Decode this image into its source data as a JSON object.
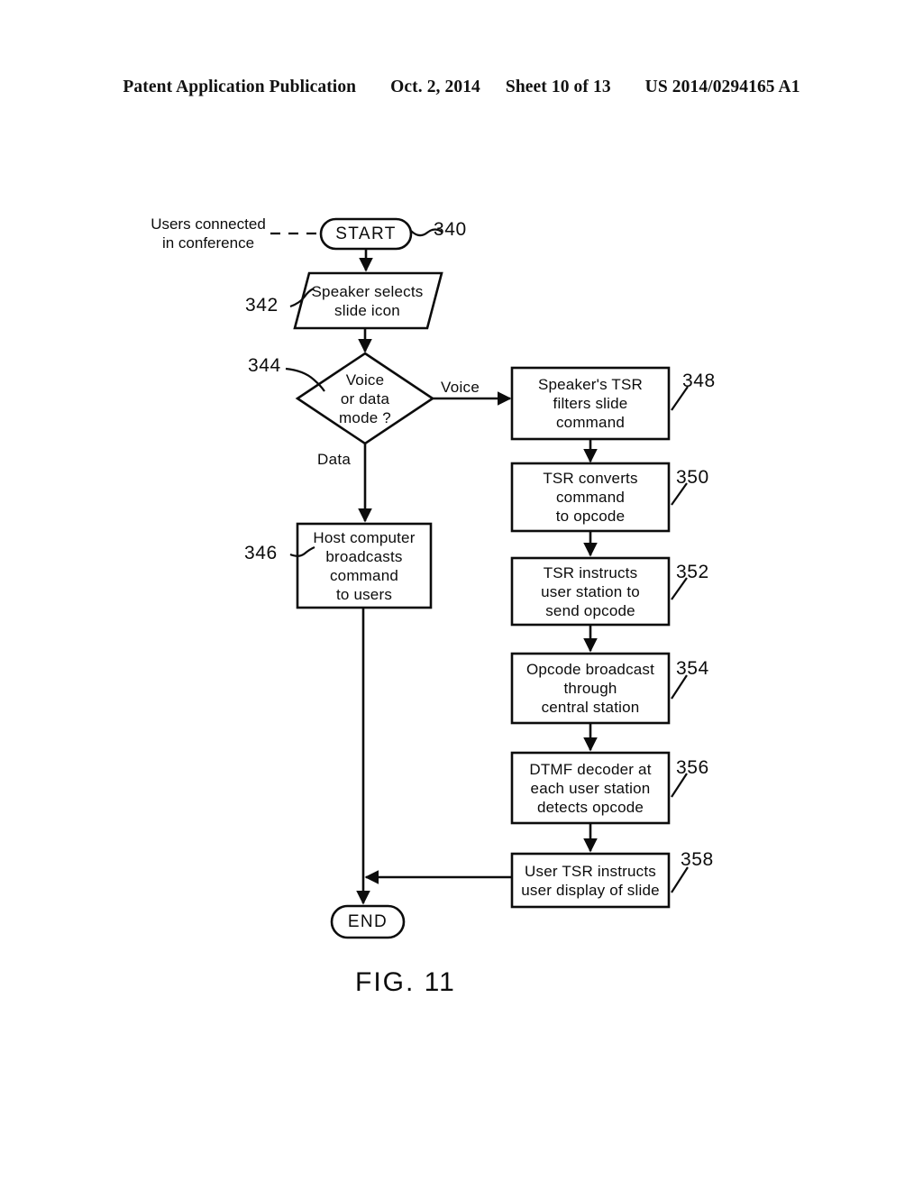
{
  "header": {
    "publication": "Patent Application Publication",
    "date": "Oct. 2, 2014",
    "sheet": "Sheet 10 of 13",
    "docnum": "US 2014/0294165 A1"
  },
  "figure": {
    "caption": "FIG. 11",
    "annotation": "Users connected\nin conference"
  },
  "nodes": {
    "start": {
      "label": "START",
      "ref": "340"
    },
    "speaker_selects": {
      "label": "Speaker selects\nslide icon",
      "ref": "342"
    },
    "decision": {
      "label": "Voice\nor data\nmode ?",
      "ref": "344"
    },
    "host_broadcast": {
      "label": "Host computer\nbroadcasts\ncommand\nto users",
      "ref": "346"
    },
    "tsr_filters": {
      "label": "Speaker's TSR\nfilters slide\ncommand",
      "ref": "348"
    },
    "tsr_converts": {
      "label": "TSR converts\ncommand\nto opcode",
      "ref": "350"
    },
    "tsr_instructs": {
      "label": "TSR instructs\nuser station to\nsend opcode",
      "ref": "352"
    },
    "opcode_broadcast": {
      "label": "Opcode broadcast\nthrough\ncentral station",
      "ref": "354"
    },
    "dtmf_decoder": {
      "label": "DTMF decoder at\neach user station\ndetects opcode",
      "ref": "356"
    },
    "user_tsr": {
      "label": "User TSR instructs\nuser display of slide",
      "ref": "358"
    },
    "end": {
      "label": "END"
    }
  },
  "edges": {
    "voice_label": "Voice",
    "data_label": "Data"
  },
  "colors": {
    "ink": "#0c0c0c",
    "paper": "#ffffff"
  }
}
